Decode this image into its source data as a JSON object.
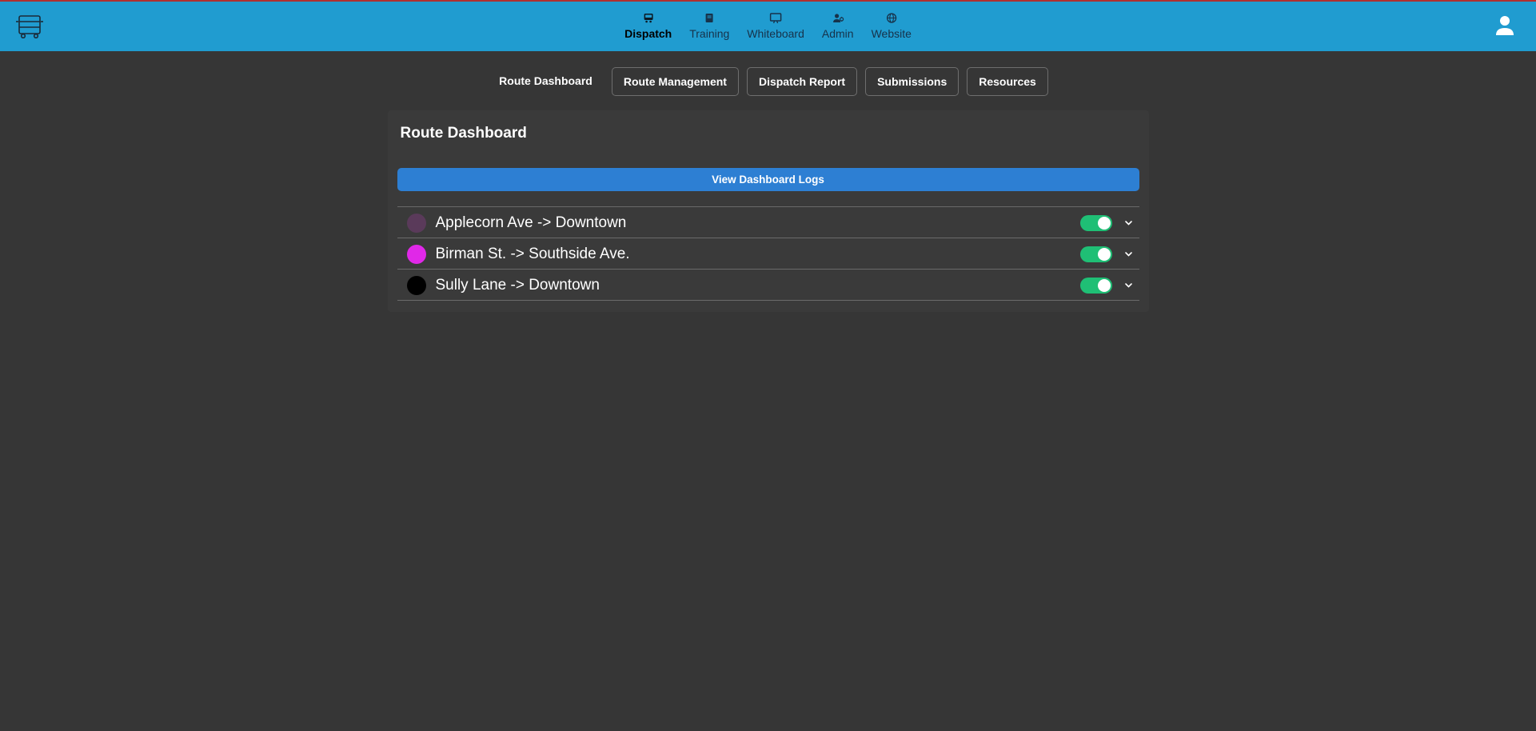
{
  "topnav": {
    "items": [
      {
        "label": "Dispatch",
        "active": true
      },
      {
        "label": "Training",
        "active": false
      },
      {
        "label": "Whiteboard",
        "active": false
      },
      {
        "label": "Admin",
        "active": false
      },
      {
        "label": "Website",
        "active": false
      }
    ]
  },
  "subnav": {
    "items": [
      {
        "label": "Route Dashboard",
        "bordered": false,
        "active": true
      },
      {
        "label": "Route Management",
        "bordered": true,
        "active": false
      },
      {
        "label": "Dispatch Report",
        "bordered": true,
        "active": false
      },
      {
        "label": "Submissions",
        "bordered": true,
        "active": false
      },
      {
        "label": "Resources",
        "bordered": true,
        "active": false
      }
    ]
  },
  "panel": {
    "title": "Route Dashboard",
    "logs_button_label": "View Dashboard Logs"
  },
  "routes": [
    {
      "name": "Applecorn Ave -> Downtown",
      "color": "#5a3a5a",
      "enabled": true
    },
    {
      "name": "Birman St. -> Southside Ave.",
      "color": "#e028e8",
      "enabled": true
    },
    {
      "name": "Sully Lane -> Downtown",
      "color": "#000000",
      "enabled": true
    }
  ]
}
